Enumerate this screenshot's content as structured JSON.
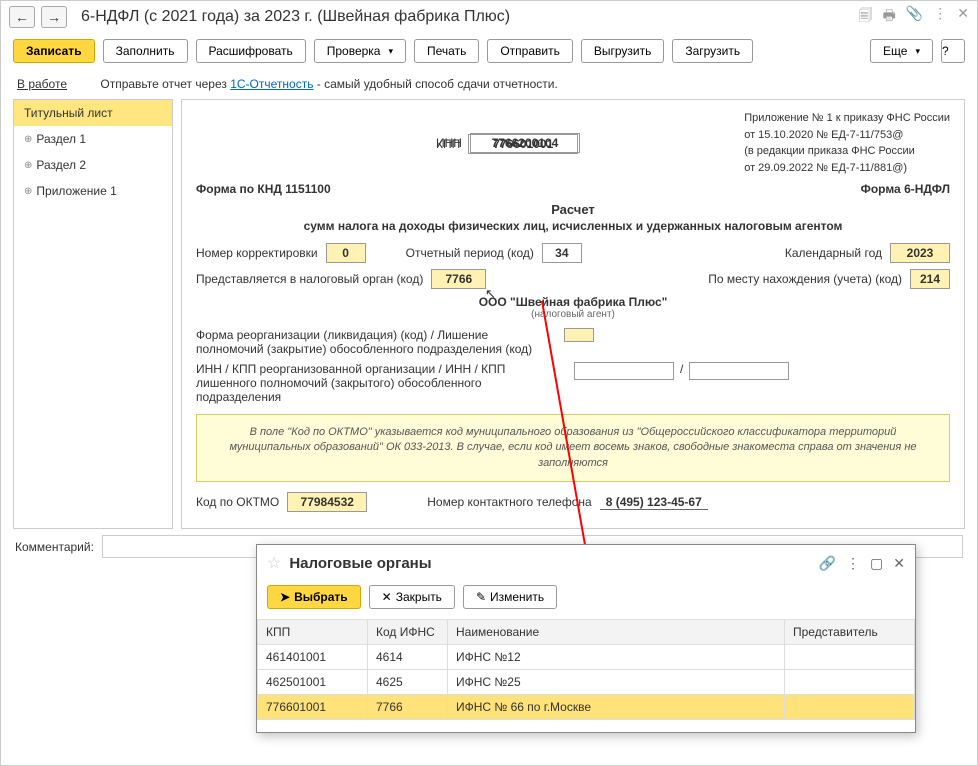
{
  "header": {
    "title": "6-НДФЛ (с 2021 года) за 2023 г. (Швейная фабрика Плюс)"
  },
  "toolbar": {
    "write": "Записать",
    "fill": "Заполнить",
    "decode": "Расшифровать",
    "check": "Проверка",
    "print": "Печать",
    "send": "Отправить",
    "unload": "Выгрузить",
    "load": "Загрузить",
    "more": "Еще"
  },
  "status": {
    "state": "В работе",
    "hint_prefix": "Отправьте отчет через ",
    "hint_link": "1C-Отчетность",
    "hint_suffix": " - самый удобный способ сдачи отчетности."
  },
  "sidebar": {
    "items": [
      {
        "label": "Титульный лист",
        "active": true
      },
      {
        "label": "Раздел 1"
      },
      {
        "label": "Раздел 2"
      },
      {
        "label": "Приложение 1"
      }
    ]
  },
  "form": {
    "inn_label": "ИНН",
    "inn": "7766200104",
    "kpp_label": "КПП",
    "kpp": "776601001",
    "app_info_1": "Приложение № 1 к приказу ФНС России",
    "app_info_2": "от 15.10.2020 № ЕД-7-11/753@",
    "app_info_3": "(в редакции приказа ФНС России",
    "app_info_4": "от 29.09.2022 № ЕД-7-11/881@)",
    "knd_label": "Форма по КНД 1151100",
    "form_name": "Форма 6-НДФЛ",
    "title": "Расчет",
    "subtitle": "сумм налога на доходы физических лиц, исчисленных и удержанных налоговым агентом",
    "corr_label": "Номер корректировки",
    "corr": "0",
    "period_label": "Отчетный период (код)",
    "period": "34",
    "year_label": "Календарный год",
    "year": "2023",
    "tax_org_label": "Представляется в налоговый орган (код)",
    "tax_org": "7766",
    "place_label": "По месту нахождения (учета) (код)",
    "place": "214",
    "org_name": "ООО \"Швейная фабрика Плюс\"",
    "org_sub": "(налоговый агент)",
    "reorg_label": "Форма реорганизации (ликвидация) (код) / Лишение полномочий (закрытие) обособленного подразделения (код)",
    "reorg_inn_label": "ИНН / КПП реорганизованной организации / ИНН / КПП лишенного полномочий (закрытого) обособленного подразделения",
    "hint": "В поле \"Код по ОКТМО\" указывается код муниципального образования из \"Общероссийского классификатора территорий муниципальных образований\" ОК 033-2013. В случае, если код имеет восемь знаков, свободные знакоместа справа от значения не заполняются",
    "oktmo_label": "Код по ОКТМО",
    "oktmo": "77984532",
    "phone_label": "Номер контактного телефона",
    "phone": "8 (495) 123-45-67"
  },
  "comment": {
    "label": "Комментарий:"
  },
  "popup": {
    "title": "Налоговые органы",
    "select": "Выбрать",
    "close": "Закрыть",
    "edit": "Изменить",
    "columns": {
      "kpp": "КПП",
      "code": "Код ИФНС",
      "name": "Наименование",
      "repr": "Представитель"
    },
    "rows": [
      {
        "kpp": "461401001",
        "code": "4614",
        "name": "ИФНС №12",
        "repr": ""
      },
      {
        "kpp": "462501001",
        "code": "4625",
        "name": "ИФНС №25",
        "repr": ""
      },
      {
        "kpp": "776601001",
        "code": "7766",
        "name": "ИФНС № 66 по г.Москве",
        "repr": "",
        "selected": true
      }
    ]
  }
}
